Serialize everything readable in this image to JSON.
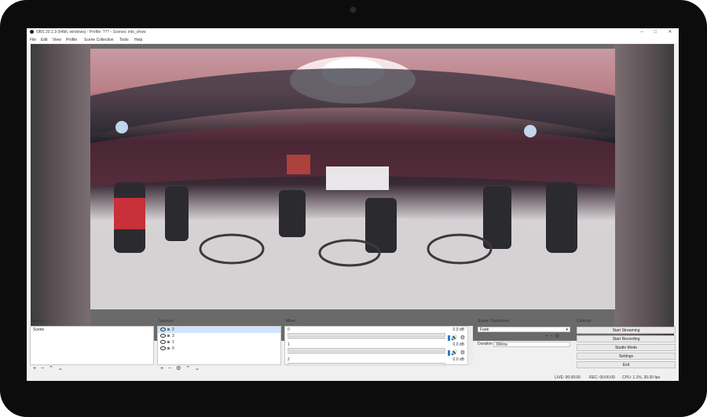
{
  "window": {
    "title": "OBS 20.1.3 (64bit, windows) - Profile: ??? - Scenes: into_show",
    "controls": [
      "–",
      "□",
      "✕"
    ]
  },
  "menu": [
    "File",
    "Edit",
    "View",
    "Profile",
    "Scene Collection",
    "Tools",
    "Help"
  ],
  "scenes": {
    "title": "Scenes",
    "items": [
      "Scene"
    ]
  },
  "sources": {
    "title": "Sources",
    "items": [
      "2",
      "3",
      "1",
      "0"
    ]
  },
  "mixer": {
    "title": "Mixer",
    "channels": [
      {
        "name": "0",
        "db": "0.0 dB"
      },
      {
        "name": "1",
        "db": "0.0 dB"
      },
      {
        "name": "2",
        "db": "0.0 dB"
      }
    ]
  },
  "transitions": {
    "title": "Scene Transitions",
    "selected": "Fade",
    "duration_label": "Duration",
    "duration_value": "300ms"
  },
  "controls": {
    "title": "Controls",
    "buttons": [
      "Start Streaming",
      "Start Recording",
      "Studio Mode",
      "Settings",
      "Exit"
    ]
  },
  "status": {
    "live": "LIVE: 00:00:00",
    "rec": "REC: 00:00:00",
    "cpu": "CPU: 1.1%, 30.00 fps"
  },
  "icons": {
    "add": "+",
    "remove": "−",
    "up": "⌃",
    "down": "⌄",
    "gear": "⚙",
    "volume": "🔊",
    "dropdown": "▾"
  },
  "colors": {
    "accent": "#2a7ad8",
    "selection": "#cfe5ff",
    "bezel": "#0c0c0c"
  }
}
